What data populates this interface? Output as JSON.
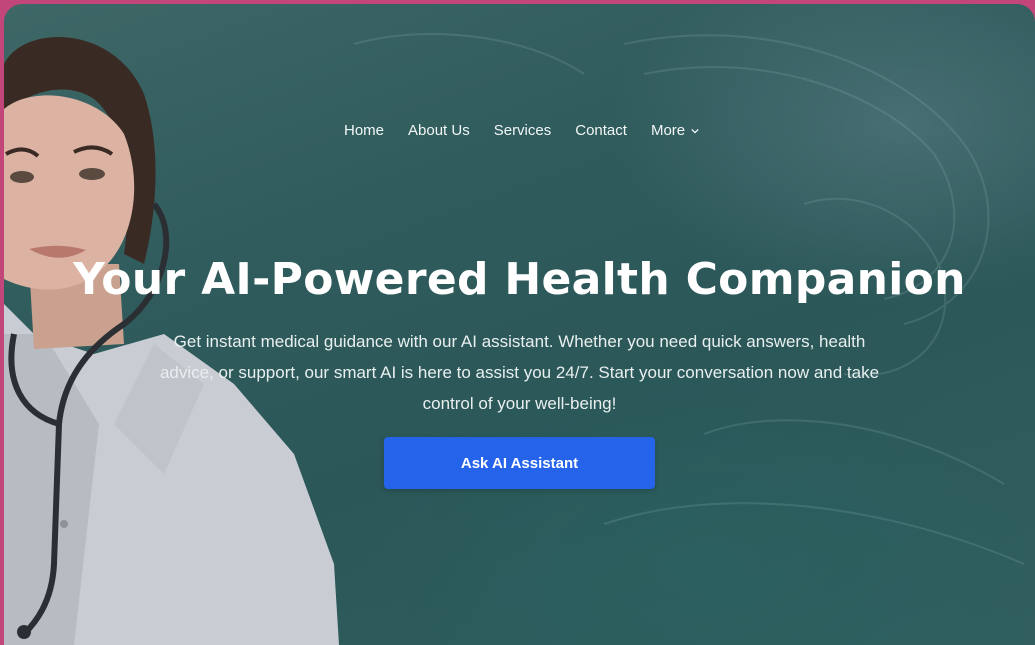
{
  "nav": {
    "items": [
      {
        "label": "Home"
      },
      {
        "label": "About Us"
      },
      {
        "label": "Services"
      },
      {
        "label": "Contact"
      },
      {
        "label": "More"
      }
    ]
  },
  "hero": {
    "title": "Your AI-Powered Health Companion",
    "description": "Get instant medical guidance with our AI assistant. Whether you need quick answers, health advice, or support, our smart AI is here to assist you 24/7. Start your conversation now and take control of your well-being!",
    "cta_label": "Ask AI Assistant"
  },
  "colors": {
    "accent": "#2563eb",
    "background": "#2f5b5c",
    "border": "#c2467a"
  },
  "icons": {
    "more_dropdown": "chevron-down-icon"
  }
}
